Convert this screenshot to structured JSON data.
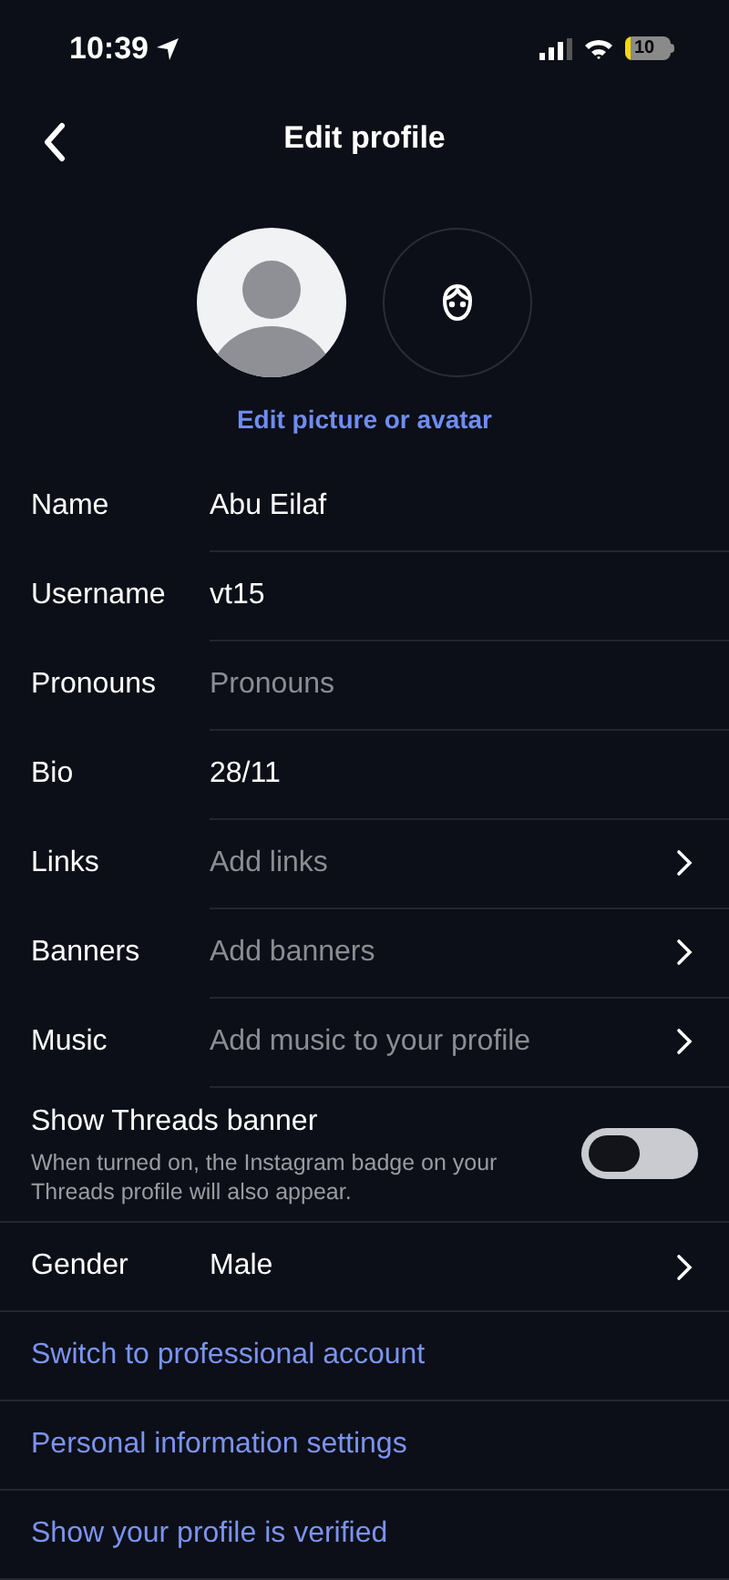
{
  "status_bar": {
    "time": "10:39",
    "battery": "10"
  },
  "header": {
    "title": "Edit profile"
  },
  "edit_picture_link": "Edit picture or avatar",
  "fields": [
    {
      "label": "Name",
      "value": "Abu Eilaf",
      "chevron": false
    },
    {
      "label": "Username",
      "value": "vt15",
      "chevron": false
    },
    {
      "label": "Pronouns",
      "placeholder": "Pronouns",
      "chevron": false
    },
    {
      "label": "Bio",
      "value": "28/11",
      "chevron": false
    },
    {
      "label": "Links",
      "placeholder": "Add links",
      "chevron": true
    },
    {
      "label": "Banners",
      "placeholder": "Add banners",
      "chevron": true
    },
    {
      "label": "Music",
      "placeholder": "Add music to your profile",
      "chevron": true
    }
  ],
  "threads_banner": {
    "title": "Show Threads banner",
    "description": "When turned on, the Instagram badge on your Threads profile will also appear.",
    "on": false
  },
  "gender": {
    "label": "Gender",
    "value": "Male",
    "chevron": true
  },
  "links": [
    "Switch to professional account",
    "Personal information settings",
    "Show your profile is verified"
  ]
}
